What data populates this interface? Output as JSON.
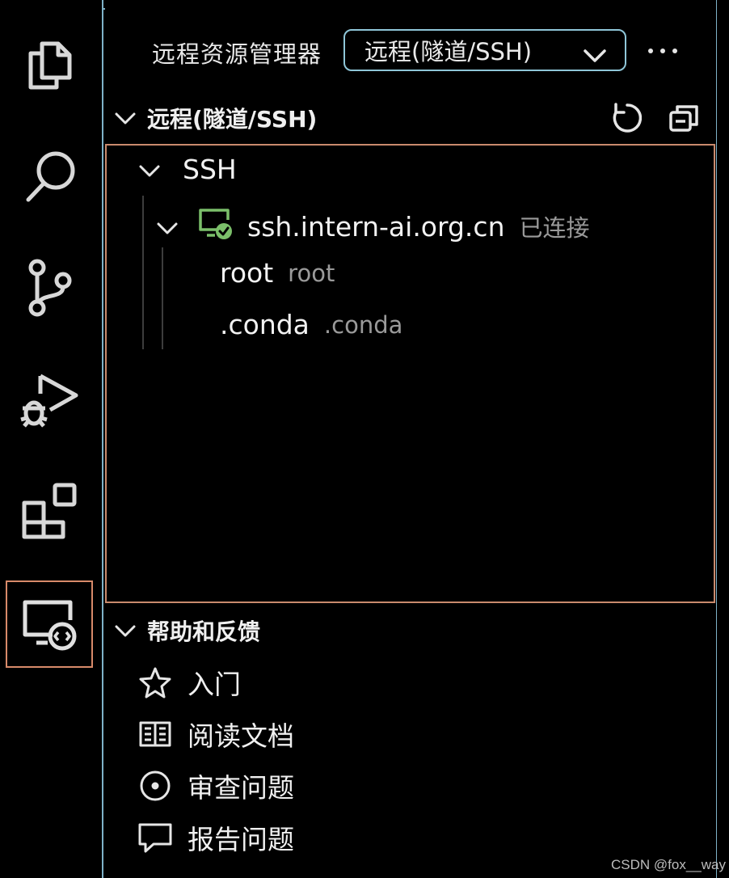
{
  "activity_bar": {
    "items": [
      {
        "icon": "files-icon"
      },
      {
        "icon": "search-icon"
      },
      {
        "icon": "source-control-icon"
      },
      {
        "icon": "run-debug-icon"
      },
      {
        "icon": "extensions-icon"
      },
      {
        "icon": "remote-explorer-icon",
        "active": true
      }
    ],
    "active_border_color": "#d88a6a"
  },
  "header": {
    "title": "远程资源管理器",
    "dropdown_value": "远程(隧道/SSH)",
    "more_icon": "ellipsis-icon"
  },
  "remote_section": {
    "title": "远程(隧道/SSH)",
    "actions": [
      "refresh-icon",
      "collapse-all-icon"
    ],
    "tree": {
      "group_label": "SSH",
      "host": {
        "name": "ssh.intern-ai.org.cn",
        "status": "已连接",
        "status_color": "#7bbf6a"
      },
      "folders": [
        {
          "name": "root",
          "desc": "root"
        },
        {
          "name": ".conda",
          "desc": ".conda"
        }
      ]
    }
  },
  "help_section": {
    "title": "帮助和反馈",
    "items": [
      {
        "label": "入门",
        "icon": "star-icon"
      },
      {
        "label": "阅读文档",
        "icon": "book-icon"
      },
      {
        "label": "审查问题",
        "icon": "issue-icon"
      },
      {
        "label": "报告问题",
        "icon": "comment-icon"
      }
    ]
  },
  "watermark": "CSDN @fox__way",
  "colors": {
    "border_blue": "#7fb2c8",
    "focus_orange": "#c98a6d",
    "description_gray": "#9a9a9a"
  }
}
